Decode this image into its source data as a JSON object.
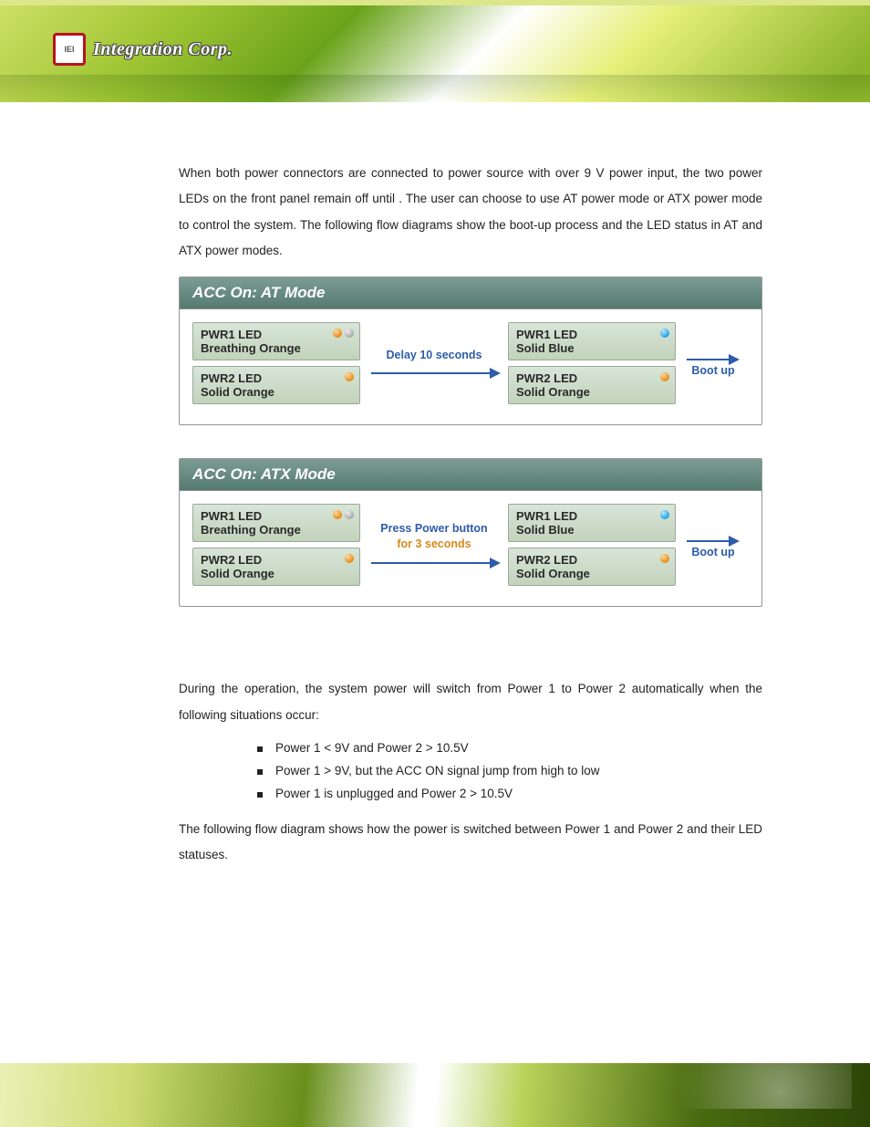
{
  "header": {
    "logo_small_text": "IEI",
    "logo_text": "Integration Corp."
  },
  "intro": {
    "p1a": "When both power connectors are connected to power source with over 9 V power input, the two power LEDs on the front panel remain off until ",
    "p1b": ". The user can choose to use AT power mode or ATX power mode to control the system. The following flow diagrams show the boot-up process and the LED status in AT and ATX power modes."
  },
  "diagram_at": {
    "title": "ACC On: AT Mode",
    "state_before": {
      "pwr1_label": "PWR1 LED",
      "pwr1_state": "Breathing Orange",
      "pwr2_label": "PWR2 LED",
      "pwr2_state": "Solid Orange"
    },
    "transition_text": "Delay 10 seconds",
    "state_after": {
      "pwr1_label": "PWR1 LED",
      "pwr1_state": "Solid Blue",
      "pwr2_label": "PWR2 LED",
      "pwr2_state": "Solid Orange"
    },
    "result": "Boot up"
  },
  "diagram_atx": {
    "title": "ACC On: ATX Mode",
    "state_before": {
      "pwr1_label": "PWR1 LED",
      "pwr1_state": "Breathing Orange",
      "pwr2_label": "PWR2 LED",
      "pwr2_state": "Solid Orange"
    },
    "transition_line1": "Press Power button",
    "transition_line2": "for 3 seconds",
    "state_after": {
      "pwr1_label": "PWR1 LED",
      "pwr1_state": "Solid Blue",
      "pwr2_label": "PWR2 LED",
      "pwr2_state": "Solid Orange"
    },
    "result": "Boot up"
  },
  "switch_section": {
    "intro": "During the operation, the system power will switch from Power 1 to Power 2 automatically when the following situations occur:",
    "bullets": [
      "Power 1 < 9V and Power 2 > 10.5V",
      "Power 1 > 9V, but the ACC ON signal jump from high to low",
      "Power 1 is unplugged and Power 2 > 10.5V"
    ],
    "outro": "The following flow diagram shows how the power is switched between Power 1 and Power 2 and their LED statuses."
  }
}
